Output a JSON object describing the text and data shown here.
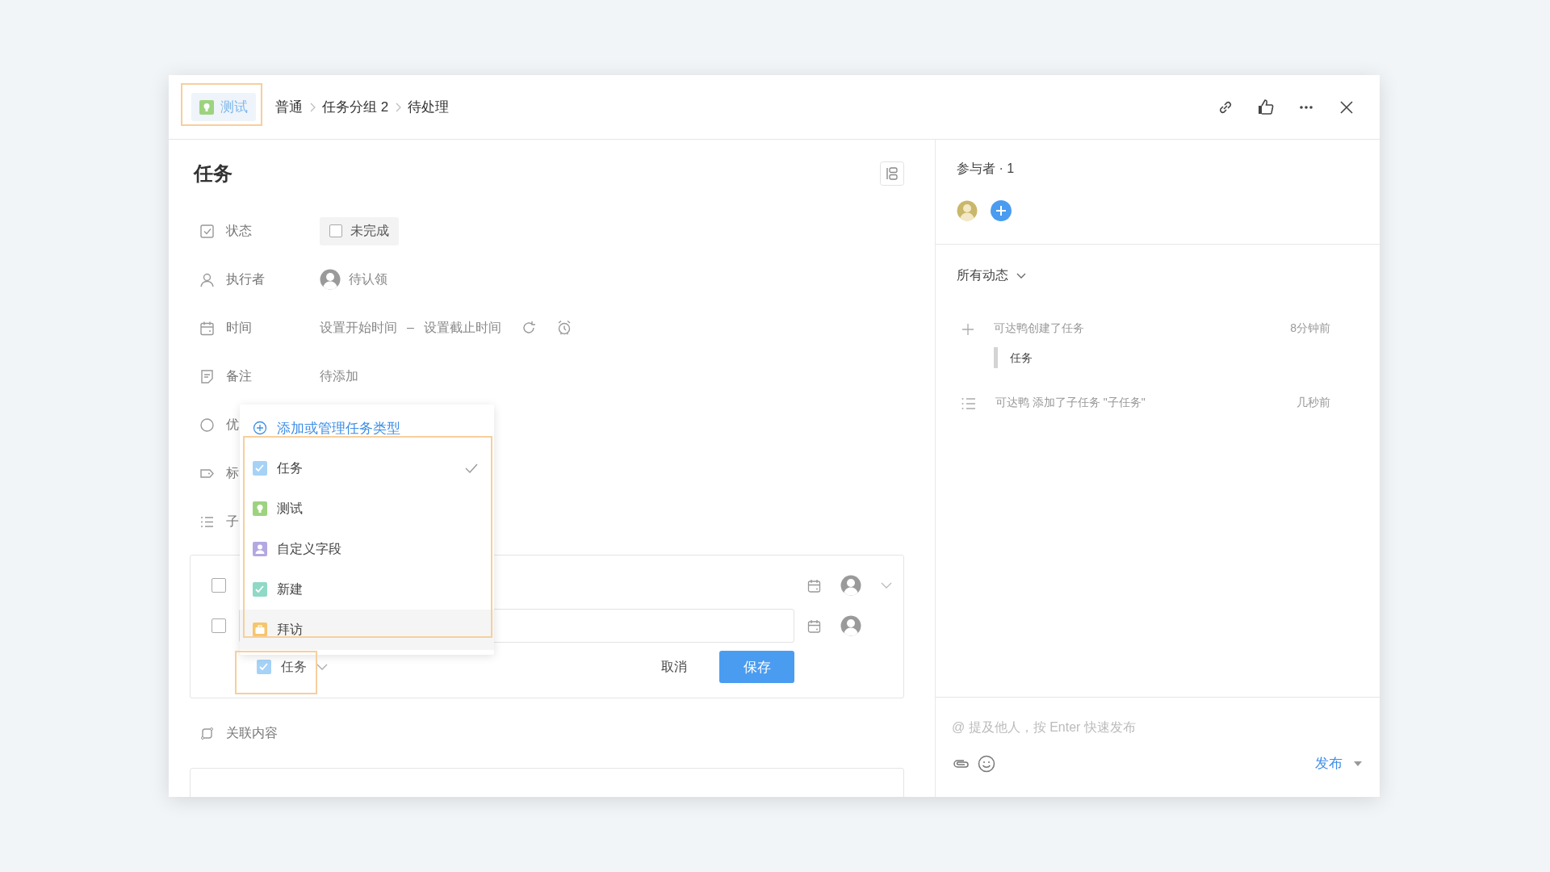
{
  "header": {
    "type_tag": {
      "label": "测试",
      "kind": "bulb",
      "color": "#9dd37f"
    },
    "breadcrumb": [
      "普通",
      "任务分组 2",
      "待处理"
    ]
  },
  "title": "任务",
  "fields": [
    {
      "kind": "status",
      "label": "状态",
      "value": "未完成",
      "checked": false
    },
    {
      "kind": "assignee",
      "label": "执行者",
      "value": "待认领"
    },
    {
      "kind": "time",
      "label": "时间",
      "start": "设置开始时间",
      "separator": "–",
      "end": "设置截止时间"
    },
    {
      "kind": "note",
      "label": "备注",
      "value": "待添加"
    },
    {
      "kind": "priority",
      "label": "优"
    },
    {
      "kind": "tag",
      "label": "标"
    },
    {
      "kind": "subtask",
      "label": "子"
    }
  ],
  "subtasks": {
    "rows": [
      {
        "kind": "existing",
        "checked": false
      },
      {
        "kind": "new",
        "checked": false
      }
    ],
    "type_select": {
      "label": "任务",
      "kind": "check",
      "color": "#a6d2f6"
    },
    "cancel": "取消",
    "save": "保存"
  },
  "related": {
    "label": "关联内容"
  },
  "type_menu": {
    "action": "添加或管理任务类型",
    "items": [
      {
        "label": "任务",
        "kind": "check",
        "color": "#a6d2f6",
        "selected": true
      },
      {
        "label": "测试",
        "kind": "bulb",
        "color": "#9dd37f",
        "selected": false
      },
      {
        "label": "自定义字段",
        "kind": "person",
        "color": "#b3a8e2",
        "selected": false
      },
      {
        "label": "新建",
        "kind": "check",
        "color": "#8fd9c6",
        "selected": false
      },
      {
        "label": "拜访",
        "kind": "case",
        "color": "#f6c66c",
        "selected": false
      }
    ]
  },
  "participants": {
    "title": "参与者 · 1"
  },
  "activity": {
    "filter": "所有动态",
    "items": [
      {
        "kind": "create",
        "text": "可达鸭创建了任务",
        "time": "8分钟前",
        "quote": "任务"
      },
      {
        "kind": "subtask",
        "text": "可达鸭 添加了子任务 \"子任务\"",
        "time": "几秒前"
      }
    ]
  },
  "composer": {
    "placeholder": "@ 提及他人，按 Enter 快速发布",
    "submit": "发布"
  }
}
